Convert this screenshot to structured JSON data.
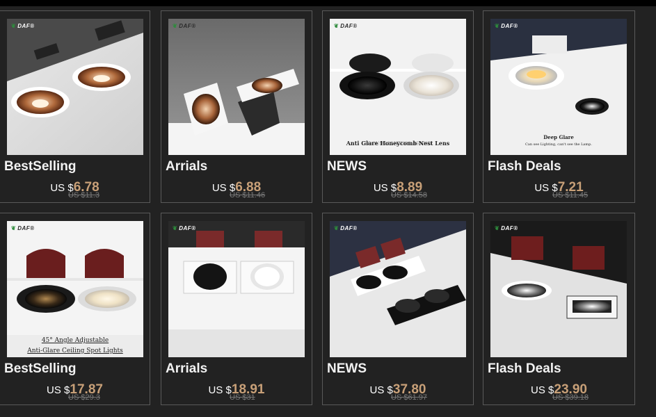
{
  "brand": "DAF",
  "colors": {
    "background": "#222222",
    "price_accent": "#c8a078",
    "title_text": "#f2f2f2",
    "old_price": "#7a7a7a"
  },
  "products": [
    {
      "title": "BestSelling",
      "currency": "US $",
      "price": "6.78",
      "old_price": "US $11.3",
      "image": "round-recessed-downlights-rose-gold"
    },
    {
      "title": "Arrials",
      "currency": "US $",
      "price": "6.88",
      "old_price": "US $11.46",
      "image": "square-adjustable-spotlights"
    },
    {
      "title": "NEWS",
      "currency": "US $",
      "price": "8.89",
      "old_price": "US $14.58",
      "image": "honeycomb-downlights-black-white",
      "caption": "Anti Glare Honeycomb Nest Lens"
    },
    {
      "title": "Flash Deals",
      "currency": "US $",
      "price": "7.21",
      "old_price": "US $11.45",
      "image": "deep-glare-downlights",
      "caption": "Deep Glare",
      "caption2": "Can see Lighting, can't see the Lamp."
    },
    {
      "title": "BestSelling",
      "currency": "US $",
      "price": "17.87",
      "old_price": "US $29.3",
      "image": "adjustable-ceiling-spot-lights",
      "caption": "45° Angle Adjustable",
      "caption2": "Anti-Glare Ceiling Spot Lights"
    },
    {
      "title": "Arrials",
      "currency": "US $",
      "price": "18.91",
      "old_price": "US $31",
      "image": "square-double-spotlights"
    },
    {
      "title": "NEWS",
      "currency": "US $",
      "price": "37.80",
      "old_price": "US $61.97",
      "image": "double-head-grille-lights"
    },
    {
      "title": "Flash Deals",
      "currency": "US $",
      "price": "23.90",
      "old_price": "US $39.18",
      "image": "chrome-reflector-downlights"
    }
  ]
}
